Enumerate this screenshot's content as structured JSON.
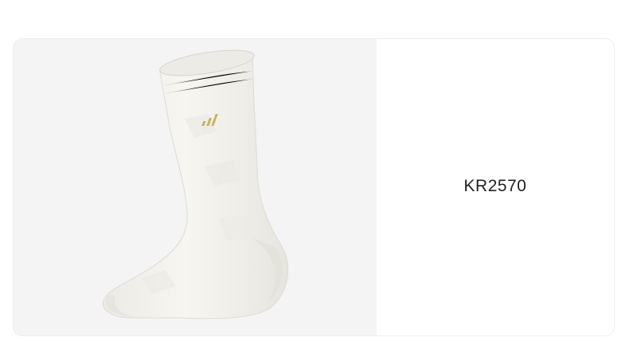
{
  "product": {
    "code": "KR2570",
    "image": {
      "subject": "white-crew-sock",
      "sock_color": "#f5f4ef",
      "logo_color": "#c8b15a",
      "background_color": "#f4f4f4"
    }
  }
}
